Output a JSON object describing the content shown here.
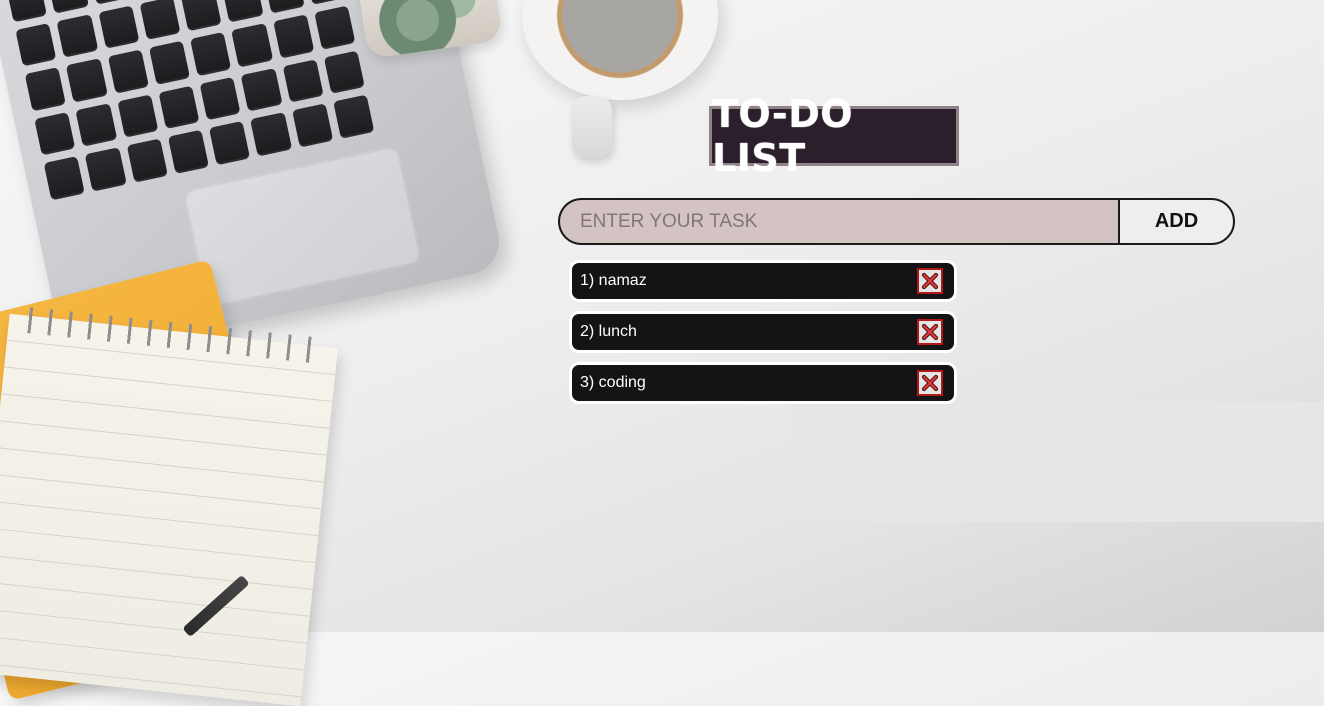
{
  "header": {
    "title": "TO-DO LIST"
  },
  "task_form": {
    "input_value": "",
    "input_placeholder": "ENTER YOUR TASK",
    "add_label": "ADD"
  },
  "tasks": [
    {
      "label": "1) namaz",
      "delete_icon": "close-x-icon"
    },
    {
      "label": "2) lunch",
      "delete_icon": "close-x-icon"
    },
    {
      "label": "3) coding",
      "delete_icon": "close-x-icon"
    }
  ],
  "colors": {
    "title_bg": "#2c1f2c",
    "input_bg": "#d3c3c3",
    "task_bg": "#141416",
    "delete_border": "#b21818"
  }
}
